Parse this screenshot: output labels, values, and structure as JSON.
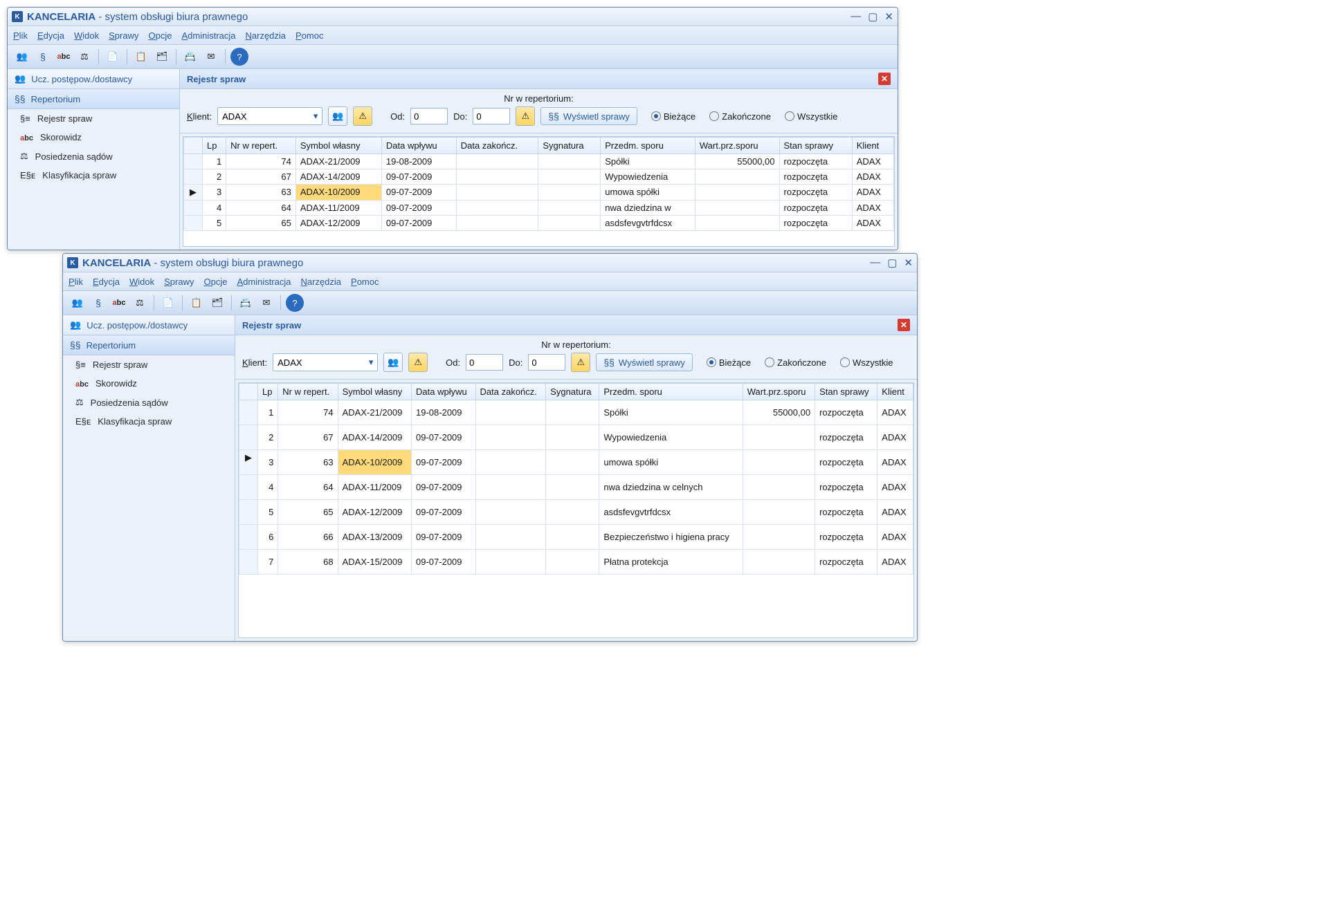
{
  "app": {
    "title_bold": "KANCELARIA",
    "title_rest": "- system obsługi biura prawnego",
    "app_icon_letter": "K"
  },
  "menu": {
    "items": [
      "Plik",
      "Edycja",
      "Widok",
      "Sprawy",
      "Opcje",
      "Administracja",
      "Narzędzia",
      "Pomoc"
    ]
  },
  "sidebar": {
    "top0": "Ucz. postępow./dostawcy",
    "top1": "Repertorium",
    "subs": [
      {
        "label": "Rejestr spraw"
      },
      {
        "label": "Skorowidz"
      },
      {
        "label": "Posiedzenia sądów"
      },
      {
        "label": "Klasyfikacja spraw"
      }
    ]
  },
  "panel": {
    "title": "Rejestr spraw"
  },
  "filter": {
    "klient_label": "Klient:",
    "klient_value": "ADAX",
    "nr_label": "Nr w repertorium:",
    "od_label": "Od:",
    "od_value": "0",
    "do_label": "Do:",
    "do_value": "0",
    "show_label": "Wyświetl sprawy",
    "r1": "Bieżące",
    "r2": "Zakończone",
    "r3": "Wszystkie"
  },
  "columns": [
    "Lp",
    "Nr w repert.",
    "Symbol własny",
    "Data wpływu",
    "Data zakończ.",
    "Sygnatura",
    "Przedm. sporu",
    "Wart.prz.sporu",
    "Stan sprawy",
    "Klient"
  ],
  "rows_compact": [
    {
      "lp": "1",
      "nr": "74",
      "sym": "ADAX-21/2009",
      "dw": "19-08-2009",
      "dz": "",
      "syg": "",
      "ps": "Spółki",
      "wart": "55000,00",
      "stan": "rozpoczęta",
      "kl": "ADAX"
    },
    {
      "lp": "2",
      "nr": "67",
      "sym": "ADAX-14/2009",
      "dw": "09-07-2009",
      "dz": "",
      "syg": "",
      "ps": "Wypowiedzenia",
      "wart": "",
      "stan": "rozpoczęta",
      "kl": "ADAX"
    },
    {
      "lp": "3",
      "nr": "63",
      "sym": "ADAX-10/2009",
      "dw": "09-07-2009",
      "dz": "",
      "syg": "",
      "ps": "umowa spółki",
      "wart": "",
      "stan": "rozpoczęta",
      "kl": "ADAX",
      "current": true,
      "hl": "sym"
    },
    {
      "lp": "4",
      "nr": "64",
      "sym": "ADAX-11/2009",
      "dw": "09-07-2009",
      "dz": "",
      "syg": "",
      "ps": "nwa dziedzina w",
      "wart": "",
      "stan": "rozpoczęta",
      "kl": "ADAX"
    },
    {
      "lp": "5",
      "nr": "65",
      "sym": "ADAX-12/2009",
      "dw": "09-07-2009",
      "dz": "",
      "syg": "",
      "ps": "asdsfevgvtrfdcsx",
      "wart": "",
      "stan": "rozpoczęta",
      "kl": "ADAX"
    }
  ],
  "rows_full": [
    {
      "lp": "1",
      "nr": "74",
      "sym": "ADAX-21/2009",
      "dw": "19-08-2009",
      "dz": "",
      "syg": "",
      "ps": "Spółki",
      "wart": "55000,00",
      "stan": "rozpoczęta",
      "kl": "ADAX"
    },
    {
      "lp": "2",
      "nr": "67",
      "sym": "ADAX-14/2009",
      "dw": "09-07-2009",
      "dz": "",
      "syg": "",
      "ps": "Wypowiedzenia",
      "wart": "",
      "stan": "rozpoczęta",
      "kl": "ADAX"
    },
    {
      "lp": "3",
      "nr": "63",
      "sym": "ADAX-10/2009",
      "dw": "09-07-2009",
      "dz": "",
      "syg": "",
      "ps": "umowa spółki",
      "wart": "",
      "stan": "rozpoczęta",
      "kl": "ADAX",
      "current": true,
      "hl": "sym"
    },
    {
      "lp": "4",
      "nr": "64",
      "sym": "ADAX-11/2009",
      "dw": "09-07-2009",
      "dz": "",
      "syg": "",
      "ps": "nwa dziedzina w celnych",
      "wart": "",
      "stan": "rozpoczęta",
      "kl": "ADAX"
    },
    {
      "lp": "5",
      "nr": "65",
      "sym": "ADAX-12/2009",
      "dw": "09-07-2009",
      "dz": "",
      "syg": "",
      "ps": "asdsfevgvtrfdcsx",
      "wart": "",
      "stan": "rozpoczęta",
      "kl": "ADAX"
    },
    {
      "lp": "6",
      "nr": "66",
      "sym": "ADAX-13/2009",
      "dw": "09-07-2009",
      "dz": "",
      "syg": "",
      "ps": "Bezpieczeństwo i higiena pracy",
      "wart": "",
      "stan": "rozpoczęta",
      "kl": "ADAX"
    },
    {
      "lp": "7",
      "nr": "68",
      "sym": "ADAX-15/2009",
      "dw": "09-07-2009",
      "dz": "",
      "syg": "",
      "ps": "Płatna protekcja",
      "wart": "",
      "stan": "rozpoczęta",
      "kl": "ADAX"
    }
  ]
}
